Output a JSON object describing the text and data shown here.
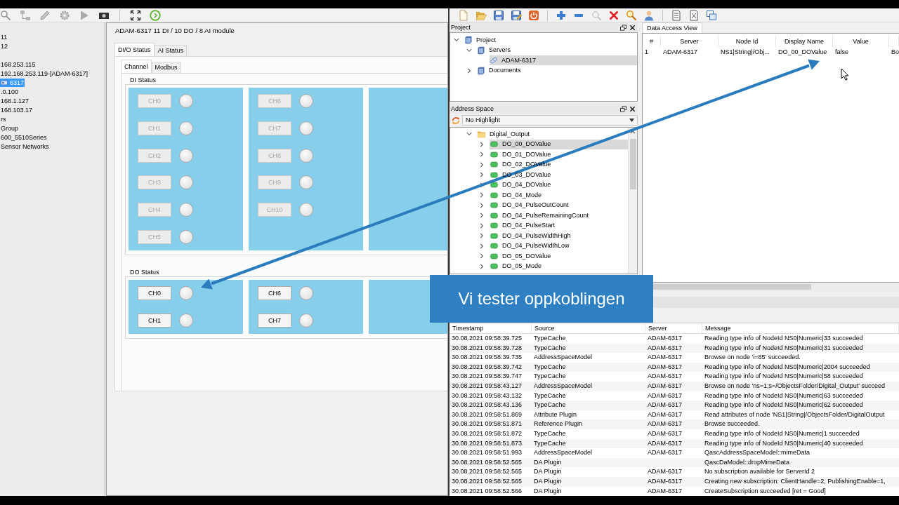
{
  "left_app": {
    "device_tree": {
      "groups": [
        {
          "items": [
            {
              "label": "11",
              "selected": false
            },
            {
              "label": "12",
              "selected": false
            }
          ]
        },
        {
          "items": [
            {
              "label": "168.253.115",
              "selected": false
            },
            {
              "label": "192.168.253.119-[ADAM-6317]",
              "selected": false,
              "children": [
                {
                  "label": "6317",
                  "selected": true
                }
              ]
            },
            {
              "label": ".0.100",
              "selected": false
            },
            {
              "label": "168.1.127",
              "selected": false
            },
            {
              "label": "168.103.17",
              "selected": false
            },
            {
              "label": "rs",
              "selected": false
            },
            {
              "label": "Group",
              "selected": false
            },
            {
              "label": "600_5510Series",
              "selected": false
            },
            {
              "label": "Sensor Networks",
              "selected": false
            }
          ]
        }
      ]
    },
    "module": {
      "title": "ADAM-6317 11 DI / 10 DO / 8 AI module",
      "tabs": [
        {
          "label": "DI/O Status",
          "selected": true
        },
        {
          "label": "AI Status",
          "selected": false
        }
      ],
      "subtabs": [
        {
          "label": "Channel",
          "selected": true
        },
        {
          "label": "Modbus",
          "selected": false
        }
      ],
      "groups": [
        {
          "title": "DI Status",
          "panels": [
            {
              "kind": "channels",
              "channels": [
                {
                  "label": "CH0",
                  "disabled": true,
                  "on": false
                },
                {
                  "label": "CH1",
                  "disabled": true,
                  "on": false
                },
                {
                  "label": "CH2",
                  "disabled": true,
                  "on": false
                },
                {
                  "label": "CH3",
                  "disabled": true,
                  "on": false
                },
                {
                  "label": "CH4",
                  "disabled": true,
                  "on": false
                },
                {
                  "label": "CH5",
                  "disabled": true,
                  "on": false
                }
              ]
            },
            {
              "kind": "channels",
              "channels": [
                {
                  "label": "CH6",
                  "disabled": true,
                  "on": false
                },
                {
                  "label": "CH7",
                  "disabled": true,
                  "on": false
                },
                {
                  "label": "CH8",
                  "disabled": true,
                  "on": false
                },
                {
                  "label": "CH9",
                  "disabled": true,
                  "on": false
                },
                {
                  "label": "CH10",
                  "disabled": true,
                  "on": false
                }
              ]
            },
            {
              "kind": "blank"
            }
          ]
        },
        {
          "title": "DO Status",
          "panels": [
            {
              "kind": "channels",
              "channels": [
                {
                  "label": "CH0",
                  "disabled": false,
                  "on": false
                },
                {
                  "label": "CH1",
                  "disabled": false,
                  "on": false
                }
              ]
            },
            {
              "kind": "channels",
              "channels": [
                {
                  "label": "CH6",
                  "disabled": false,
                  "on": false
                },
                {
                  "label": "CH7",
                  "disabled": false,
                  "on": false
                }
              ]
            },
            {
              "kind": "blank"
            }
          ]
        }
      ]
    }
  },
  "right_app": {
    "project_panel": {
      "title": "Project",
      "tree": [
        {
          "label": "Project",
          "expanded": true,
          "selected": false,
          "children": [
            {
              "label": "Servers",
              "expanded": true,
              "selected": false,
              "children": [
                {
                  "label": "ADAM-6317",
                  "selected": true
                }
              ]
            },
            {
              "label": "Documents",
              "expanded": false,
              "selected": false
            }
          ]
        }
      ]
    },
    "address_space": {
      "title": "Address Space",
      "filter": "No Highlight",
      "tree": [
        {
          "label": "Digital_Output",
          "expanded": true,
          "selected": false,
          "children": [
            {
              "label": "DO_00_DOValue",
              "expanded": false,
              "selected": true
            },
            {
              "label": "DO_01_DOValue",
              "expanded": false,
              "selected": false
            },
            {
              "label": "DO_02_DOValue",
              "expanded": false,
              "selected": false
            },
            {
              "label": "DO_03_DOValue",
              "expanded": false,
              "selected": false
            },
            {
              "label": "DO_04_DOValue",
              "expanded": false,
              "selected": false
            },
            {
              "label": "DO_04_Mode",
              "expanded": false,
              "selected": false
            },
            {
              "label": "DO_04_PulseOutCount",
              "expanded": false,
              "selected": false
            },
            {
              "label": "DO_04_PulseRemainingCount",
              "expanded": false,
              "selected": false
            },
            {
              "label": "DO_04_PulseStart",
              "expanded": false,
              "selected": false
            },
            {
              "label": "DO_04_PulseWidthHigh",
              "expanded": false,
              "selected": false
            },
            {
              "label": "DO_04_PulseWidthLow",
              "expanded": false,
              "selected": false
            },
            {
              "label": "DO_05_DOValue",
              "expanded": false,
              "selected": false
            },
            {
              "label": "DO_05_Mode",
              "expanded": false,
              "selected": false
            }
          ]
        }
      ]
    },
    "data_access_view": {
      "tab": "Data Access View",
      "columns": [
        "#",
        "Server",
        "Node Id",
        "Display Name",
        "Value"
      ],
      "rows": [
        {
          "cells": [
            "1",
            "ADAM-6317",
            "NS1|String|/Obj...",
            "DO_00_DOValue",
            "false",
            "Bo"
          ]
        }
      ]
    },
    "log": {
      "columns": [
        "Timestamp",
        "Source",
        "Server",
        "Message"
      ],
      "rows": [
        {
          "timestamp": "30.08.2021 09:58:39.725",
          "source": "TypeCache",
          "server": "ADAM-6317",
          "message": "Reading type info of NodeId NS0|Numeric|33 succeeded"
        },
        {
          "timestamp": "30.08.2021 09:58:39.728",
          "source": "TypeCache",
          "server": "ADAM-6317",
          "message": "Reading type info of NodeId NS0|Numeric|31 succeeded"
        },
        {
          "timestamp": "30.08.2021 09:58:39.735",
          "source": "AddressSpaceModel",
          "server": "ADAM-6317",
          "message": "Browse on node 'i=85' succeeded."
        },
        {
          "timestamp": "30.08.2021 09:58:39.742",
          "source": "TypeCache",
          "server": "ADAM-6317",
          "message": "Reading type info of NodeId NS0|Numeric|2004 succeeded"
        },
        {
          "timestamp": "30.08.2021 09:58:39.747",
          "source": "TypeCache",
          "server": "ADAM-6317",
          "message": "Reading type info of NodeId NS0|Numeric|58 succeeded"
        },
        {
          "timestamp": "30.08.2021 09:58:43.127",
          "source": "AddressSpaceModel",
          "server": "ADAM-6317",
          "message": "Browse on node 'ns=1;s=/ObjectsFolder/Digital_Output' succeed"
        },
        {
          "timestamp": "30.08.2021 09:58:43.132",
          "source": "TypeCache",
          "server": "ADAM-6317",
          "message": "Reading type info of NodeId NS0|Numeric|63 succeeded"
        },
        {
          "timestamp": "30.08.2021 09:58:43.136",
          "source": "TypeCache",
          "server": "ADAM-6317",
          "message": "Reading type info of NodeId NS0|Numeric|62 succeeded"
        },
        {
          "timestamp": "30.08.2021 09:58:51.869",
          "source": "Attribute Plugin",
          "server": "ADAM-6317",
          "message": "Read attributes of node 'NS1|String|/ObjectsFolder/DigitalOutput"
        },
        {
          "timestamp": "30.08.2021 09:58:51.871",
          "source": "Reference Plugin",
          "server": "ADAM-6317",
          "message": "Browse succeeded."
        },
        {
          "timestamp": "30.08.2021 09:58:51.872",
          "source": "TypeCache",
          "server": "ADAM-6317",
          "message": "Reading type info of NodeId NS0|Numeric|1 succeeded"
        },
        {
          "timestamp": "30.08.2021 09:58:51.873",
          "source": "TypeCache",
          "server": "ADAM-6317",
          "message": "Reading type info of NodeId NS0|Numeric|40 succeeded"
        },
        {
          "timestamp": "30.08.2021 09:58:51.993",
          "source": "AddressSpaceModel",
          "server": "ADAM-6317",
          "message": "QascAddressSpaceModel::mimeData"
        },
        {
          "timestamp": "30.08.2021 09:58:52.565",
          "source": "DA Plugin",
          "message": "QascDaModel::dropMimeData"
        },
        {
          "timestamp": "30.08.2021 09:58:52.565",
          "source": "DA Plugin",
          "server": "ADAM-6317",
          "message": "No subscription available for ServerId 2"
        },
        {
          "timestamp": "30.08.2021 09:58:52.565",
          "source": "DA Plugin",
          "server": "ADAM-6317",
          "message": "Creating new subscription: ClientHandle=2, PublishingEnable=1,"
        },
        {
          "timestamp": "30.08.2021 09:58:52.566",
          "source": "DA Plugin",
          "server": "ADAM-6317",
          "message": "CreateSubscription succeeded [ret = Good]"
        }
      ]
    }
  },
  "caption": "Vi tester oppkoblingen"
}
